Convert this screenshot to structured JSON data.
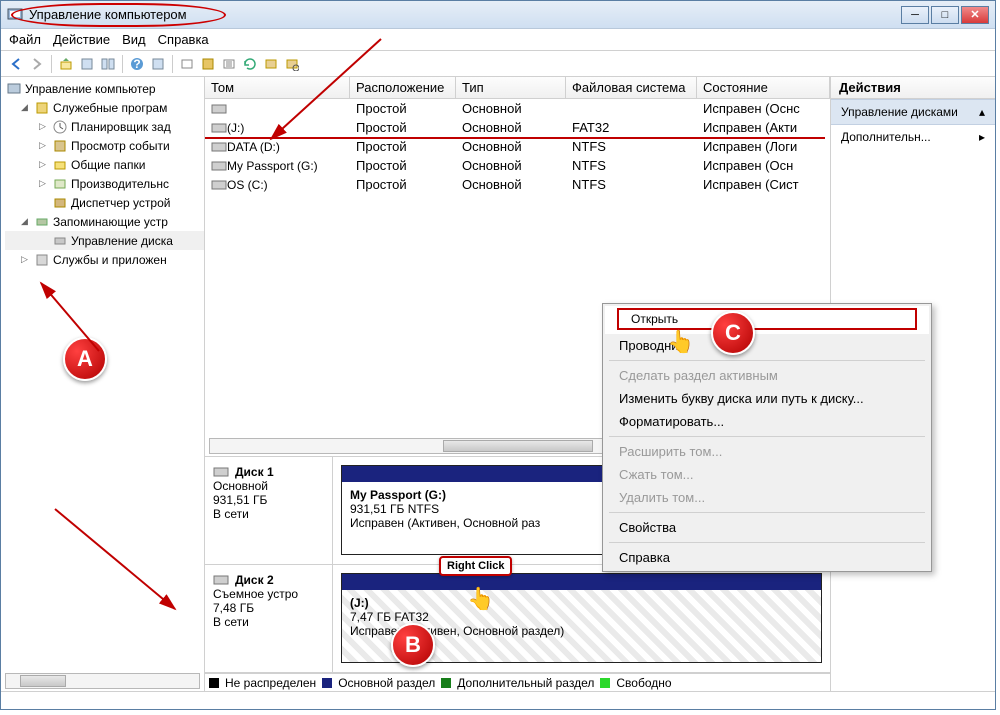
{
  "window": {
    "title": "Управление компьютером"
  },
  "menu": {
    "file": "Файл",
    "action": "Действие",
    "view": "Вид",
    "help": "Справка"
  },
  "tree": {
    "root": "Управление компьютер",
    "utilities": "Служебные програм",
    "scheduler": "Планировщик зад",
    "eventviewer": "Просмотр событи",
    "sharedfolders": "Общие папки",
    "performance": "Производительнс",
    "devicemgr": "Диспетчер устрой",
    "storage": "Запоминающие устр",
    "diskmgmt": "Управление диска",
    "services": "Службы и приложен"
  },
  "columns": {
    "volume": "Том",
    "layout": "Расположение",
    "type": "Тип",
    "fs": "Файловая система",
    "status": "Состояние"
  },
  "volumes": [
    {
      "name": "",
      "layout": "Простой",
      "type": "Основной",
      "fs": "",
      "status": "Исправен (Оснс"
    },
    {
      "name": "(J:)",
      "layout": "Простой",
      "type": "Основной",
      "fs": "FAT32",
      "status": "Исправен (Акти"
    },
    {
      "name": "DATA (D:)",
      "layout": "Простой",
      "type": "Основной",
      "fs": "NTFS",
      "status": "Исправен (Логи"
    },
    {
      "name": "My Passport (G:)",
      "layout": "Простой",
      "type": "Основной",
      "fs": "NTFS",
      "status": "Исправен (Осн"
    },
    {
      "name": "OS (C:)",
      "layout": "Простой",
      "type": "Основной",
      "fs": "NTFS",
      "status": "Исправен (Сист"
    }
  ],
  "disks": {
    "d1": {
      "title": "Диск 1",
      "kind": "Основной",
      "size": "931,51 ГБ",
      "state": "В сети",
      "vol_name": "My Passport  (G:)",
      "vol_size": "931,51 ГБ NTFS",
      "vol_status": "Исправен (Активен, Основной раз"
    },
    "d2": {
      "title": "Диск 2",
      "kind": "Съемное устро",
      "size": "7,48 ГБ",
      "state": "В сети",
      "vol_name": "(J:)",
      "vol_size": "7,47 ГБ FAT32",
      "vol_status": "Исправен (Активен, Основной раздел)"
    }
  },
  "legend": {
    "unalloc": "Не распределен",
    "primary": "Основной раздел",
    "extended": "Дополнительный раздел",
    "free": "Свободно"
  },
  "actions": {
    "head": "Действия",
    "diskmgmt": "Управление дисками",
    "more": "Дополнительн..."
  },
  "context": {
    "open": "Открыть",
    "explore": "Проводник",
    "active": "Сделать раздел активным",
    "changeletter": "Изменить букву диска или путь к диску...",
    "format": "Форматировать...",
    "extend": "Расширить том...",
    "shrink": "Сжать том...",
    "delete": "Удалить том...",
    "properties": "Свойства",
    "help": "Справка"
  },
  "annotations": {
    "rightclick": "Right Click"
  },
  "badges": {
    "a": "A",
    "b": "B",
    "c": "C"
  }
}
